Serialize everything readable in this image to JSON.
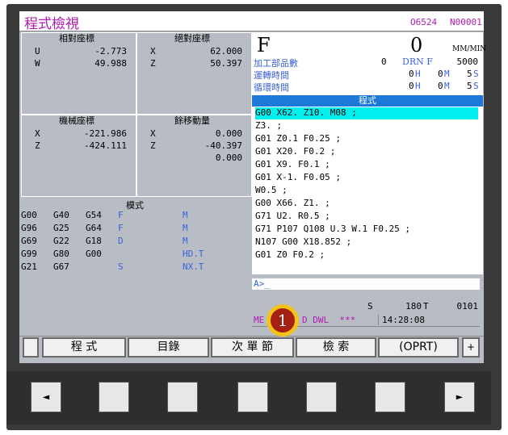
{
  "header": {
    "title": "程式檢視",
    "program": "O6524",
    "sequence": "N00001"
  },
  "relative": {
    "title": "相對座標",
    "rows": [
      {
        "axis": "U",
        "value": "-2.773"
      },
      {
        "axis": "W",
        "value": "49.988"
      }
    ]
  },
  "absolute": {
    "title": "絕對座標",
    "rows": [
      {
        "axis": "X",
        "value": "62.000"
      },
      {
        "axis": "Z",
        "value": "50.397"
      }
    ]
  },
  "machine": {
    "title": "機械座標",
    "rows": [
      {
        "axis": "X",
        "value": "-221.986"
      },
      {
        "axis": "Z",
        "value": "-424.111"
      }
    ]
  },
  "remaining": {
    "title": "餘移動量",
    "rows": [
      {
        "axis": "X",
        "value": "0.000"
      },
      {
        "axis": "Z",
        "value": "-40.397"
      },
      {
        "axis": "",
        "value": "0.000"
      }
    ]
  },
  "modal": {
    "title": "模式",
    "rows": [
      [
        "G00",
        "G40",
        "G54",
        "F",
        "M"
      ],
      [
        "G96",
        "G25",
        "G64",
        "F",
        "M"
      ],
      [
        "G69",
        "G22",
        "G18",
        "D",
        "M"
      ],
      [
        "G99",
        "G80",
        "G00",
        "",
        "HD.T"
      ],
      [
        "G21",
        "G67",
        "",
        "S",
        "NX.T"
      ]
    ]
  },
  "feed": {
    "letter": "F",
    "value": "0",
    "unit": "MM/MIN"
  },
  "counters": [
    {
      "label": "加工部品數",
      "value": "0",
      "extra_label": "DRN F",
      "extra_value": "5000"
    },
    {
      "label": "運轉時間",
      "h": "0",
      "m": "0",
      "s": "5",
      "hl": "H",
      "ml": "M",
      "sl": "S"
    },
    {
      "label": "循環時間",
      "h": "0",
      "m": "0",
      "s": "5",
      "hl": "H",
      "ml": "M",
      "sl": "S"
    }
  ],
  "program_section": {
    "title": "程式"
  },
  "code_lines": [
    "G00 X62. Z10. M08 ;",
    "Z3. ;",
    "G01 Z0.1 F0.25 ;",
    "G01 X20. F0.2 ;",
    "G01 X9. F0.1 ;",
    "G01 X-1. F0.05 ;",
    "W0.5 ;",
    "G00 X66. Z1. ;",
    "G71 U2. R0.5 ;",
    "G71 P107 Q108 U.3 W.1 F0.25 ;",
    "N107 G00 X18.852 ;",
    "G01 Z0 F0.2 ;"
  ],
  "input": {
    "prompt": "A>_"
  },
  "status": {
    "s_label": "S",
    "s_value": "180",
    "t_label": "T",
    "t_value": "0101",
    "mode_left": "ME",
    "mode_right": "D DWL  ***",
    "time": "14:28:08"
  },
  "softkeys": [
    "程 式",
    "目錄",
    "次 單 節",
    "檢 索",
    "(OPRT)"
  ],
  "softkey_plus": "+",
  "badge": "1",
  "keys": {
    "left": "◄",
    "right": "►"
  }
}
